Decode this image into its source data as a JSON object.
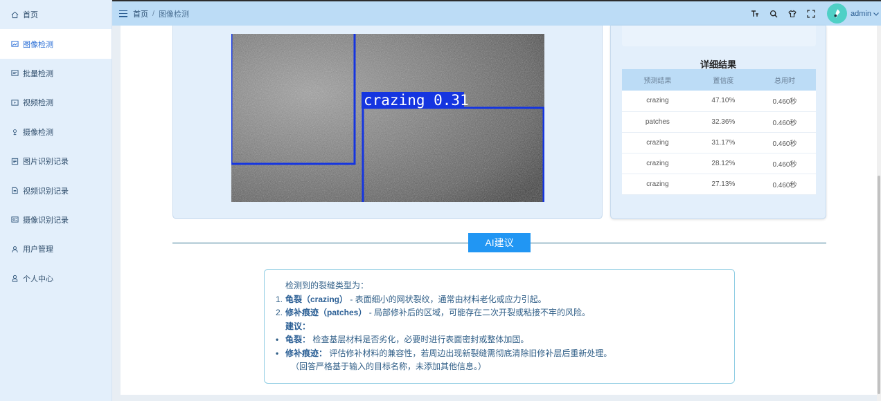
{
  "sidebar": {
    "items": [
      {
        "label": "首页",
        "icon": "home-icon"
      },
      {
        "label": "图像检测",
        "icon": "image-icon",
        "active": true
      },
      {
        "label": "批量检测",
        "icon": "batch-icon"
      },
      {
        "label": "视频检测",
        "icon": "video-icon"
      },
      {
        "label": "摄像检测",
        "icon": "camera-icon"
      },
      {
        "label": "图片识别记录",
        "icon": "image-record-icon"
      },
      {
        "label": "视频识别记录",
        "icon": "video-record-icon"
      },
      {
        "label": "摄像识别记录",
        "icon": "camera-record-icon"
      },
      {
        "label": "用户管理",
        "icon": "user-manage-icon"
      },
      {
        "label": "个人中心",
        "icon": "profile-icon"
      }
    ]
  },
  "header": {
    "breadcrumb": [
      "首页",
      "图像检测"
    ],
    "separator": "/",
    "username": "admin",
    "tools": [
      "font-size-icon",
      "search-icon",
      "shirt-theme-icon",
      "fullscreen-icon"
    ]
  },
  "detection": {
    "box_label": "crazing 0.31",
    "box_color": "#1535e0"
  },
  "results": {
    "title": "详细结果",
    "headers": [
      "预测结果",
      "置信度",
      "总用时"
    ],
    "rows": [
      [
        "crazing",
        "47.10%",
        "0.460秒"
      ],
      [
        "patches",
        "32.36%",
        "0.460秒"
      ],
      [
        "crazing",
        "31.17%",
        "0.460秒"
      ],
      [
        "crazing",
        "28.12%",
        "0.460秒"
      ],
      [
        "crazing",
        "27.13%",
        "0.460秒"
      ]
    ]
  },
  "ai": {
    "button_label": "AI建议",
    "intro": "检测到的裂缝类型为：",
    "items": [
      {
        "num": "1.",
        "term": "龟裂（crazing）",
        "desc": " - 表面细小的网状裂纹，通常由材料老化或应力引起。"
      },
      {
        "num": "2.",
        "term": "修补痕迹（patches）",
        "desc": " - 局部修补后的区域，可能存在二次开裂或粘接不牢的风险。"
      }
    ],
    "suggest_title": "建议：",
    "suggestions": [
      {
        "term": "龟裂：",
        "desc": " 检查基层材料是否劣化，必要时进行表面密封或整体加固。"
      },
      {
        "term": "修补痕迹：",
        "desc": " 评估修补材料的兼容性，若周边出现新裂缝需彻底清除旧修补层后重新处理。"
      }
    ],
    "note": "（回答严格基于输入的目标名称，未添加其他信息。）"
  },
  "colors": {
    "accent": "#2196f3",
    "sidebar_bg": "#e3effb",
    "header_bg": "#bcdcf6"
  }
}
